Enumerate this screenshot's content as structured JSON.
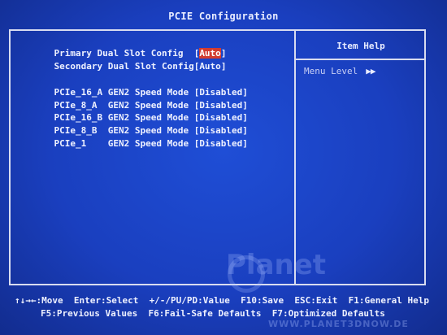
{
  "title": "PCIE Configuration",
  "help": {
    "title": "Item Help",
    "menu_level_label": "Menu Level",
    "menu_level_arrow": "▶▶"
  },
  "settings": [
    {
      "label": "Primary Dual Slot Config  ",
      "value": "Auto"
    },
    {
      "label": "Secondary Dual Slot Config",
      "value": "Auto"
    },
    {
      "label": "PCIe_16_A GEN2 Speed Mode ",
      "value": "Disabled"
    },
    {
      "label": "PCIe_8_A  GEN2 Speed Mode ",
      "value": "Disabled"
    },
    {
      "label": "PCIe_16_B GEN2 Speed Mode ",
      "value": "Disabled"
    },
    {
      "label": "PCIe_8_B  GEN2 Speed Mode ",
      "value": "Disabled"
    },
    {
      "label": "PCIe_1    GEN2 Speed Mode ",
      "value": "Disabled"
    }
  ],
  "footer": {
    "line1": "↑↓→←:Move  Enter:Select  +/-/PU/PD:Value  F10:Save  ESC:Exit  F1:General Help",
    "line2": "F5:Previous Values  F6:Fail-Safe Defaults  F7:Optimized Defaults"
  },
  "watermark": {
    "brand": "Planet",
    "url": "WWW.PLANET3DNOW.DE"
  },
  "colors": {
    "bios_blue": "#1a3fbf",
    "selected_bg": "#d23b2f",
    "text": "#eef1ff"
  }
}
